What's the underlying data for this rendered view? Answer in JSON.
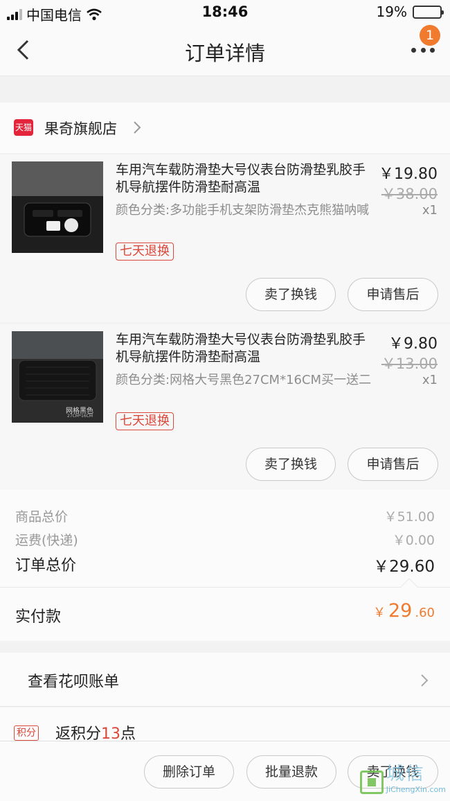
{
  "status_bar": {
    "carrier": "中国电信",
    "time": "18:46",
    "battery": "19%",
    "battery_level": 0.19
  },
  "nav": {
    "title": "订单详情",
    "badge": "1"
  },
  "store": {
    "logo_text": "天猫",
    "name": "果奇旗舰店"
  },
  "products": [
    {
      "title": "车用汽车载防滑垫大号仪表台防滑垫乳胶手机导航摆件防滑垫耐高温",
      "sku": "颜色分类:多功能手机支架防滑垫杰克熊猫呐喊",
      "tag": "七天退换",
      "price": "￥19.80",
      "orig_price": "￥38.00",
      "qty": "x1",
      "btn_sell": "卖了换钱",
      "btn_service": "申请售后"
    },
    {
      "title": "车用汽车载防滑垫大号仪表台防滑垫乳胶手机导航摆件防滑垫耐高温",
      "sku": "颜色分类:网格大号黑色27CM*16CM买一送二",
      "tag": "七天退换",
      "price": "￥9.80",
      "orig_price": "￥13.00",
      "qty": "x1",
      "btn_sell": "卖了换钱",
      "btn_service": "申请售后",
      "image_caption": "网格黑色",
      "image_subcaption": "27CM*16CM"
    }
  ],
  "totals": {
    "goods_label": "商品总价",
    "goods_value": "￥51.00",
    "shipping_label": "运费(快递)",
    "shipping_value": "￥0.00",
    "order_label": "订单总价",
    "order_value": "￥29.60"
  },
  "paid": {
    "label": "实付款",
    "yen": "￥",
    "int": "29",
    "dec": ".60"
  },
  "huabei": {
    "label": "查看花呗账单"
  },
  "points": {
    "tag": "积分",
    "prefix": "返积分",
    "number": "13",
    "suffix": "点"
  },
  "bottom": {
    "delete": "删除订单",
    "refund": "批量退款",
    "sell": "卖了换钱"
  },
  "watermark": {
    "cn": "城信",
    "en": "JiChengXin.com"
  },
  "colors": {
    "accent_orange": "#f07a2e",
    "tag_red": "#d9483b",
    "tmall_red": "#e3243a"
  }
}
